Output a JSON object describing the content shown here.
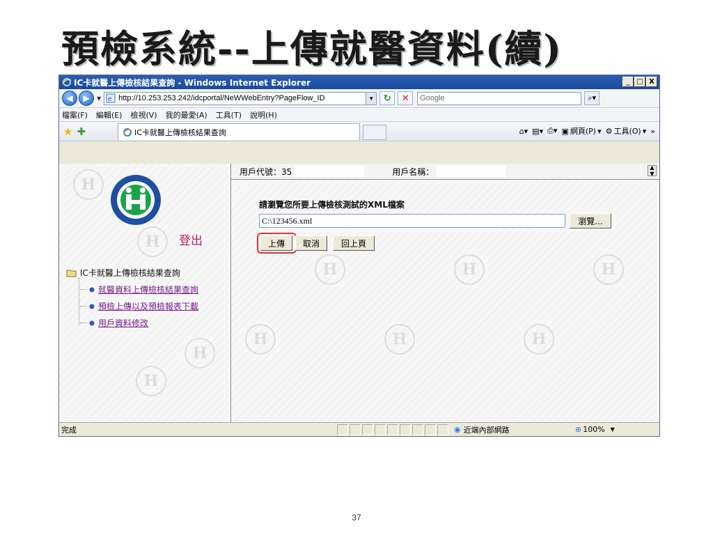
{
  "slide": {
    "title": "預檢系統--上傳就醫資料(續)",
    "page_number": "37"
  },
  "window": {
    "title": "IC卡就醫上傳檢核結果查詢 - Windows Internet Explorer",
    "btn_minimize": "_",
    "btn_maximize": "□",
    "btn_close": "X"
  },
  "address": {
    "url": "http://10.253.253.242/idcportal/NeWWebEntry?PageFlow_ID",
    "search_placeholder": "Google"
  },
  "menu": {
    "items": [
      "檔案(F)",
      "編輯(E)",
      "檢視(V)",
      "我的最愛(A)",
      "工具(T)",
      "說明(H)"
    ]
  },
  "tab": {
    "label": "IC卡就醫上傳檢核結果查詢"
  },
  "commands": {
    "page": "網頁(P)",
    "tools": "工具(O)",
    "more": "»"
  },
  "sidebar": {
    "logout": "登出",
    "tree_root": "IC卡就醫上傳檢核結果查詢",
    "links": [
      "就醫資料上傳檢核結果查詢",
      "預檢上傳以及預檢報表下載",
      "用戶資料修改"
    ]
  },
  "info": {
    "user_code_label": "用戶代號：35",
    "user_name_label": "用戶名稱："
  },
  "form": {
    "prompt": "請瀏覽您所要上傳檢核測試的XML檔案",
    "file_value": "C:\\123456.xml",
    "browse": "瀏覽...",
    "upload": "上傳",
    "cancel": "取消",
    "back": "回上頁"
  },
  "status": {
    "text": "完成",
    "zone": "近端內部網路",
    "zoom": "100%"
  },
  "colors": {
    "titlebar": "#1a4a9c",
    "link": "#7a1a8c",
    "logout": "#b0246b",
    "highlight": "#e03030"
  }
}
